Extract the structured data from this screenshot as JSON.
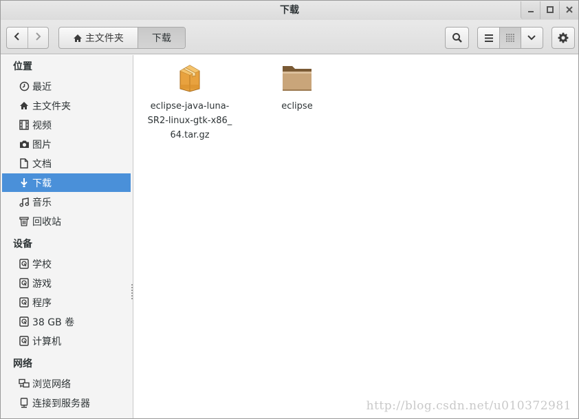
{
  "window": {
    "title": "下载"
  },
  "headerbar": {
    "path": {
      "home_label": "主文件夹",
      "current_label": "下载"
    }
  },
  "sidebar": {
    "sections": [
      {
        "title": "位置",
        "items": [
          {
            "label": "最近",
            "icon": "clock-icon"
          },
          {
            "label": "主文件夹",
            "icon": "home-icon"
          },
          {
            "label": "视频",
            "icon": "film-icon"
          },
          {
            "label": "图片",
            "icon": "camera-icon"
          },
          {
            "label": "文档",
            "icon": "document-icon"
          },
          {
            "label": "下载",
            "icon": "download-icon",
            "active": true
          },
          {
            "label": "音乐",
            "icon": "music-icon"
          },
          {
            "label": "回收站",
            "icon": "trash-icon"
          }
        ]
      },
      {
        "title": "设备",
        "items": [
          {
            "label": "学校",
            "icon": "drive-icon"
          },
          {
            "label": "游戏",
            "icon": "drive-icon"
          },
          {
            "label": "程序",
            "icon": "drive-icon"
          },
          {
            "label": "38 GB 卷",
            "icon": "drive-icon"
          },
          {
            "label": "计算机",
            "icon": "drive-icon"
          }
        ]
      },
      {
        "title": "网络",
        "items": [
          {
            "label": "浏览网络",
            "icon": "network-icon"
          },
          {
            "label": "连接到服务器",
            "icon": "server-icon"
          }
        ]
      }
    ]
  },
  "files": [
    {
      "name": "eclipse-java-luna-\nSR2-linux-gtk-x86_\n64.tar.gz",
      "icon": "archive-icon"
    },
    {
      "name": "eclipse",
      "icon": "folder-icon"
    }
  ],
  "watermark": "http://blog.csdn.net/u010372981",
  "colors": {
    "selection": "#4a90d9"
  }
}
